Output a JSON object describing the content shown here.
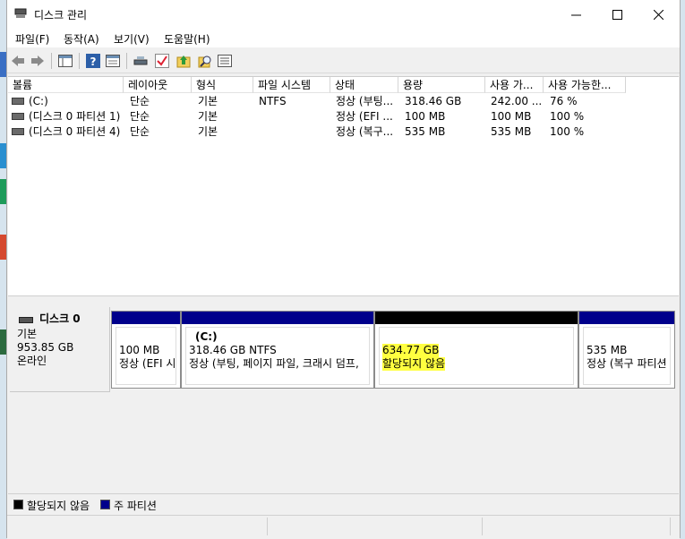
{
  "window": {
    "title": "디스크 관리",
    "minimize_glyph": "—",
    "maximize_glyph": "☐",
    "close_glyph": "✕"
  },
  "menu": [
    "파일(F)",
    "동작(A)",
    "보기(V)",
    "도움말(H)"
  ],
  "toolbar_icons": [
    "back-arrow-icon",
    "forward-arrow-icon",
    "console-tree-icon",
    "help-icon",
    "properties-icon",
    "rescan-icon",
    "checkmark-icon",
    "up-folder-icon",
    "search-disk-icon",
    "list-view-icon"
  ],
  "volume_table": {
    "columns": [
      "볼륨",
      "레이아웃",
      "형식",
      "파일 시스템",
      "상태",
      "용량",
      "사용 가...",
      "사용 가능한..."
    ],
    "rows": [
      [
        "(C:)",
        "단순",
        "기본",
        "NTFS",
        "정상 (부팅...",
        "318.46 GB",
        "242.00 ...",
        "76 %"
      ],
      [
        "(디스크 0 파티션 1)",
        "단순",
        "기본",
        "",
        "정상 (EFI ...",
        "100 MB",
        "100 MB",
        "100 %"
      ],
      [
        "(디스크 0 파티션 4)",
        "단순",
        "기본",
        "",
        "정상 (복구...",
        "535 MB",
        "535 MB",
        "100 %"
      ]
    ]
  },
  "disk": {
    "name": "디스크 0",
    "type": "기본",
    "size": "953.85 GB",
    "status": "온라인"
  },
  "partitions": [
    {
      "line1": "100 MB",
      "line2": "정상 (EFI 시",
      "line0": ""
    },
    {
      "line0": "(C:)",
      "line1": "318.46 GB NTFS",
      "line2": "정상 (부팅, 페이지 파일, 크래시 덤프,"
    },
    {
      "line0": "",
      "line1": "634.77 GB",
      "line2": "할당되지 않음"
    },
    {
      "line0": "",
      "line1": "535 MB",
      "line2": "정상 (복구 파티션"
    }
  ],
  "legend": [
    {
      "label": "할당되지 않음",
      "color": "#000000"
    },
    {
      "label": "주 파티션",
      "color": "#00008b"
    }
  ],
  "colors": {
    "primary_partition": "#00008b",
    "unallocated": "#000000",
    "highlight": "#ffff40"
  }
}
